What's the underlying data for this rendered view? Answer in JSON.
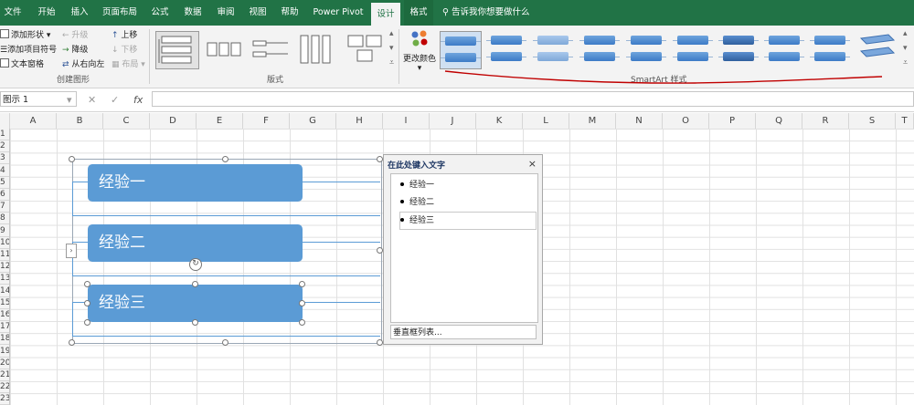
{
  "tabs": [
    {
      "label": "文件"
    },
    {
      "label": "开始"
    },
    {
      "label": "插入"
    },
    {
      "label": "页面布局"
    },
    {
      "label": "公式"
    },
    {
      "label": "数据"
    },
    {
      "label": "审阅"
    },
    {
      "label": "视图"
    },
    {
      "label": "帮助"
    },
    {
      "label": "Power Pivot"
    },
    {
      "label": "设计"
    },
    {
      "label": "格式"
    }
  ],
  "tell_me": "告诉我你想要做什么",
  "ribbon": {
    "create_graphic": {
      "add_shape": "添加形状",
      "add_bullet": "添加项目符号",
      "text_pane": "文本窗格",
      "promote": "升级",
      "demote": "降级",
      "right_to_left": "从右向左",
      "move_up": "上移",
      "move_down": "下移",
      "layout": "布局",
      "group_label": "创建图形"
    },
    "layouts_label": "版式",
    "change_colors": "更改颜色",
    "styles_label": "SmartArt 样式"
  },
  "formula_bar": {
    "name_box": "图示 1",
    "cancel_icon": "✕",
    "enter_icon": "✓",
    "fx_icon": "fx"
  },
  "columns": [
    "A",
    "B",
    "C",
    "D",
    "E",
    "F",
    "G",
    "H",
    "I",
    "J",
    "K",
    "L",
    "M",
    "N",
    "O",
    "P",
    "Q",
    "R",
    "S",
    "T"
  ],
  "rows": [
    "1",
    "2",
    "3",
    "4",
    "5",
    "6",
    "7",
    "8",
    "9",
    "10",
    "11",
    "12",
    "13",
    "14",
    "15",
    "16",
    "17",
    "18",
    "19",
    "20",
    "21",
    "22",
    "23"
  ],
  "smartart": {
    "items": [
      "经验一",
      "经验二",
      "经验三"
    ]
  },
  "text_pane": {
    "title": "在此处键入文字",
    "close": "×",
    "items": [
      "经验一",
      "经验二",
      "经验三"
    ],
    "footer": "垂直框列表..."
  },
  "colors": {
    "tab_bar": "#217346",
    "smartart_fill": "#5b9bd5",
    "annotation_red": "#c00000"
  }
}
